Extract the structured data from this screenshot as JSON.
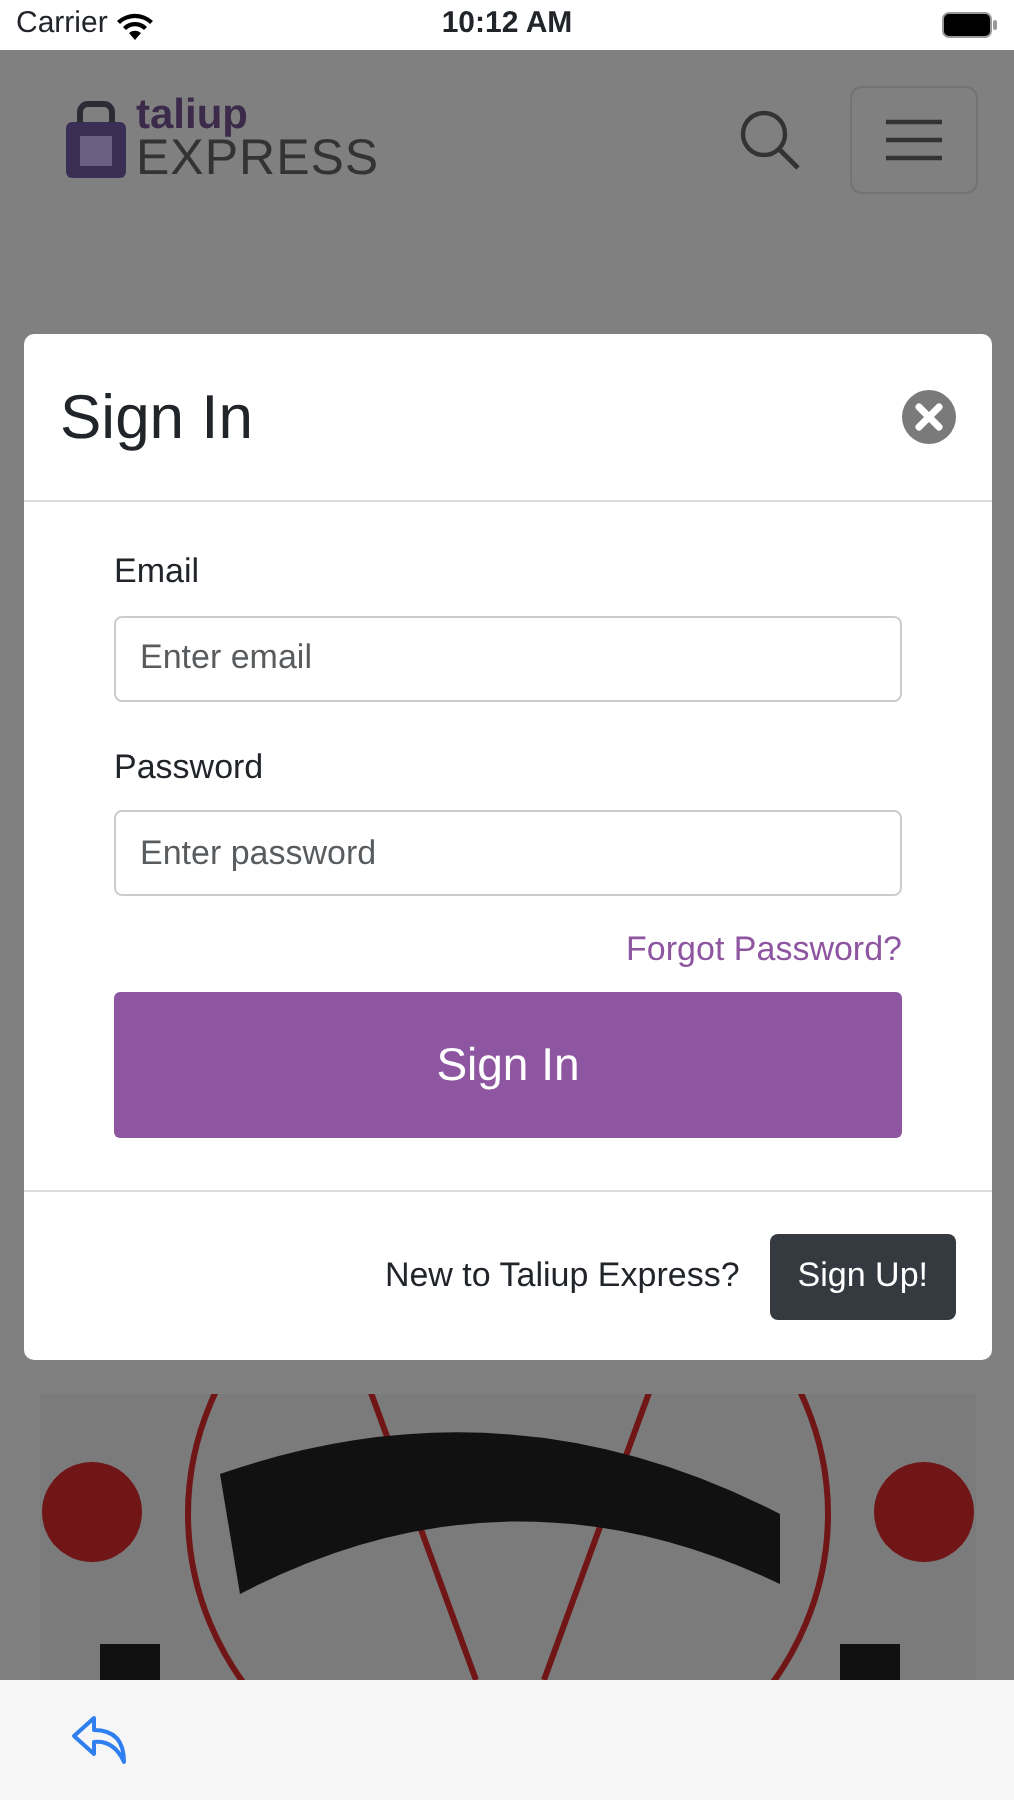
{
  "status_bar": {
    "carrier": "Carrier",
    "time": "10:12 AM"
  },
  "header": {
    "logo_top": "taliup",
    "logo_bottom": "EXPRESS"
  },
  "modal": {
    "title": "Sign In",
    "fields": [
      {
        "label": "Email",
        "placeholder": "Enter email"
      },
      {
        "label": "Password",
        "placeholder": "Enter password"
      }
    ],
    "forgot_link": "Forgot Password?",
    "submit": "Sign In",
    "footer_text": "New to Taliup Express?",
    "signup": "Sign Up!"
  }
}
